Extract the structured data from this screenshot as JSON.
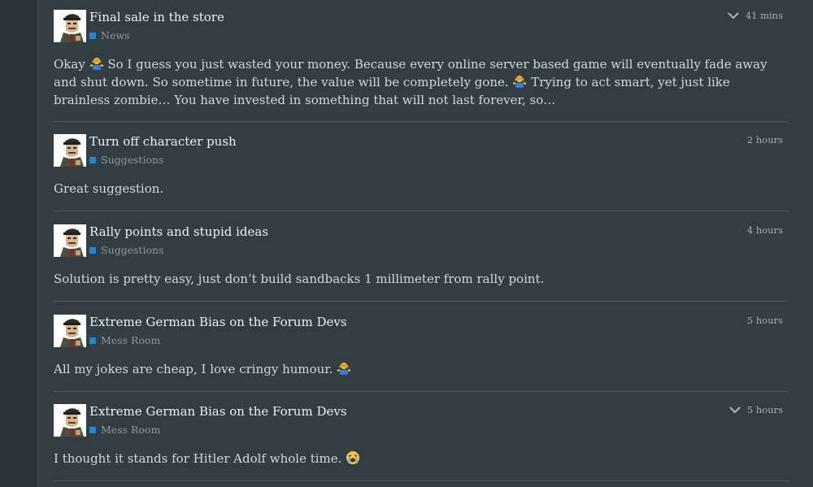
{
  "posts": [
    {
      "title": "Final sale in the store",
      "category": "News",
      "category_color": "#1e88d8",
      "time": "41 mins",
      "has_chevron": true,
      "excerpt": [
        "Okay ",
        " So I guess you just wasted your money. Because every online server based game will eventually fade away and shut down. So sometime in future, the value will be completely gone. ",
        " Trying to act smart, yet just like brainless zombie… You have invested in something that will not last forever, so…"
      ],
      "emojis": [
        "person-shrugging-emoji",
        "person-shrugging-emoji"
      ]
    },
    {
      "title": "Turn off character push",
      "category": "Suggestions",
      "category_color": "#1e88d8",
      "time": "2 hours",
      "has_chevron": false,
      "excerpt": [
        "Great suggestion."
      ],
      "emojis": []
    },
    {
      "title": "Rally points and stupid ideas",
      "category": "Suggestions",
      "category_color": "#1e88d8",
      "time": "4 hours",
      "has_chevron": false,
      "excerpt": [
        "Solution is pretty easy, just don’t build sandbacks 1 millimeter from rally point."
      ],
      "emojis": []
    },
    {
      "title": "Extreme German Bias on the Forum Devs",
      "category": "Mess Room",
      "category_color": "#1e88d8",
      "time": "5 hours",
      "has_chevron": false,
      "excerpt": [
        "All my jokes are cheap, I love cringy humour. "
      ],
      "emojis": [
        "person-shrugging-emoji"
      ]
    },
    {
      "title": "Extreme German Bias on the Forum Devs",
      "category": "Mess Room",
      "category_color": "#1e88d8",
      "time": "5 hours",
      "has_chevron": true,
      "excerpt": [
        "I thought it stands for Hitler Adolf whole time. "
      ],
      "emojis": [
        "loudly-crying-face-emoji"
      ]
    }
  ]
}
